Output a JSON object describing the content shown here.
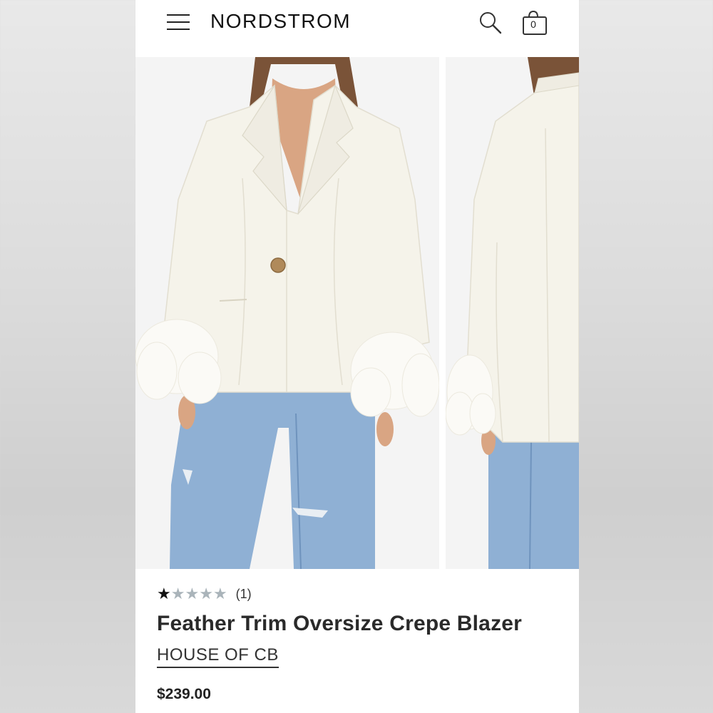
{
  "header": {
    "logo": "NORDSTROM",
    "bag_count": "0"
  },
  "product": {
    "rating": 1,
    "rating_max": 5,
    "review_count": "(1)",
    "title": "Feather Trim Oversize Crepe Blazer",
    "brand": "HOUSE OF CB",
    "price": "$239.00"
  },
  "colors": {
    "star_filled": "#111111",
    "star_empty": "#aab4ba",
    "blazer": "#f5f3ea",
    "denim": "#8fb0d4"
  },
  "icons": [
    "hamburger-menu-icon",
    "search-icon",
    "shopping-bag-icon",
    "star-icon"
  ]
}
